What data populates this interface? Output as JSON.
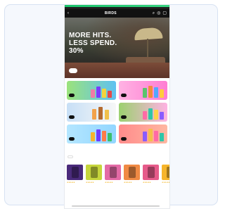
{
  "nav": {
    "brand": "BIRDS",
    "left_icon": "chevron-left-icon",
    "right_icons": [
      "search-icon",
      "user-icon",
      "cart-icon"
    ]
  },
  "hero": {
    "title_lines": [
      "MORE HITS.",
      "LESS SPEND.",
      "30%"
    ],
    "subtitle": "",
    "cta": ""
  },
  "promos": [
    {
      "text": "",
      "cta": "",
      "bg": "#9be37b"
    },
    {
      "text": "",
      "cta": "",
      "bg": "#ffb2e3"
    },
    {
      "text": "",
      "cta": "",
      "bg": "#c7dff6"
    },
    {
      "text": "",
      "cta": "",
      "bg": "#9bd16f"
    },
    {
      "text": "",
      "cta": "",
      "bg": "#b4e6ff"
    },
    {
      "text": "",
      "cta": "",
      "bg": "#ff8b8b"
    }
  ],
  "products_section": {
    "title": "",
    "filter": ""
  },
  "products": [
    {
      "name": "",
      "meta": "",
      "price": "",
      "color": "#4a2a7b"
    },
    {
      "name": "",
      "meta": "",
      "price": "",
      "color": "#c6d53c"
    },
    {
      "name": "",
      "meta": "",
      "price": "",
      "color": "#e36aa6"
    },
    {
      "name": "",
      "meta": "",
      "price": "",
      "color": "#f08a44"
    },
    {
      "name": "",
      "meta": "",
      "price": "",
      "color": "#e65b8a"
    },
    {
      "name": "",
      "meta": "",
      "price": "",
      "color": "#f6b52b"
    }
  ]
}
